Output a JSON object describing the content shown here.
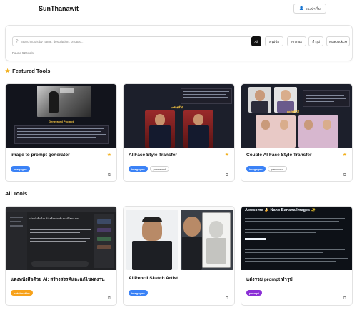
{
  "header": {
    "brand": "SunThanawit",
    "profile_label": "แนะนำเว็บ",
    "profile_icon": "user-icon"
  },
  "search": {
    "placeholder": "Search tools by name, description, or tags...",
    "value": "",
    "filters": [
      "All",
      "สรุปข้อ",
      "Prompt",
      "ทำรูป",
      "NotebookLM"
    ],
    "active_filter": "All",
    "found_text": "Found 52 tools"
  },
  "featured": {
    "title": "Featured Tools",
    "cards": [
      {
        "title": "image to prompt generator",
        "tags": [
          {
            "label": "imagegen",
            "style": "blue"
          }
        ],
        "starred": true,
        "thumb_caption": "Generated Prompt"
      },
      {
        "title": "AI Face Style Transfer",
        "tags": [
          {
            "label": "imagegen",
            "style": "blue"
          },
          {
            "label": "password",
            "style": "outline"
          }
        ],
        "starred": true,
        "thumb_caption": "ผลลัพธ์ที่ได้"
      },
      {
        "title": "Couple AI Face Style Transfer",
        "tags": [
          {
            "label": "imagegen",
            "style": "blue"
          },
          {
            "label": "password",
            "style": "outline"
          }
        ],
        "starred": true,
        "thumb_caption": "ผลลัพธ์ที่ได้"
      }
    ]
  },
  "all_tools": {
    "title": "All Tools",
    "cards": [
      {
        "title": "แต่งหนังสือด้วย AI: สร้างสรรค์และแก้ไขผลงาน",
        "tags": [
          {
            "label": "notebooklm",
            "style": "orange"
          }
        ],
        "thumb_caption": "แต่งหนังสือด้วย AI: สร้างสรรค์และแก้ไขผลงาน"
      },
      {
        "title": "AI Pencil Sketch Artist",
        "tags": [
          {
            "label": "imagegen",
            "style": "blue"
          }
        ]
      },
      {
        "title": "แต่งรวม prompt ทำรูป",
        "tags": [
          {
            "label": "prompt",
            "style": "purple"
          }
        ],
        "thumb_caption": "Awesome 🍌 Nano Banana Images ✨"
      }
    ]
  },
  "colors": {
    "accent": "#111111",
    "star": "#f2b01e",
    "tag_blue": "#3b82f6",
    "tag_orange": "#f7a21b",
    "tag_purple": "#8b2fd6"
  }
}
